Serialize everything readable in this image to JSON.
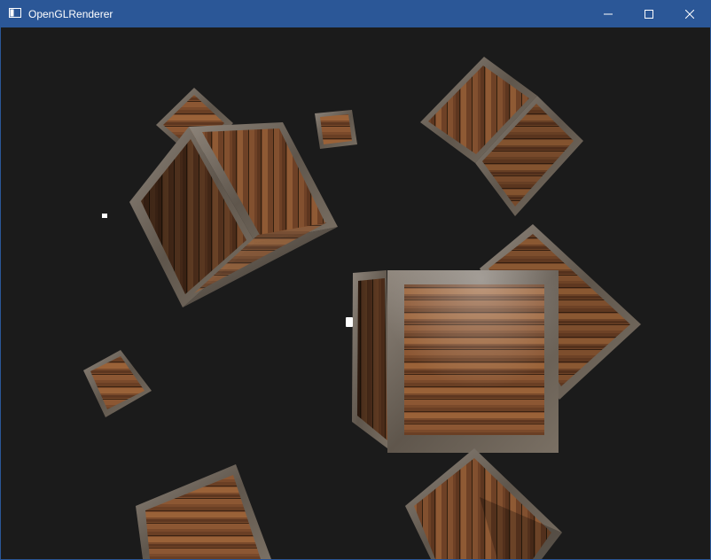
{
  "window": {
    "title": "OpenGLRenderer",
    "controls": {
      "minimize_icon": "minimize-icon",
      "maximize_icon": "maximize-icon",
      "close_icon": "close-icon"
    },
    "accent_color": "#2b5797"
  },
  "scene": {
    "background_color": "#1b1b1b",
    "object_kind": "wooden-crate",
    "crate_count": 12,
    "light_count": 2,
    "light_color": "#ffffff",
    "wood_color": "#7a4a2b",
    "frame_color": "#6e6459"
  }
}
